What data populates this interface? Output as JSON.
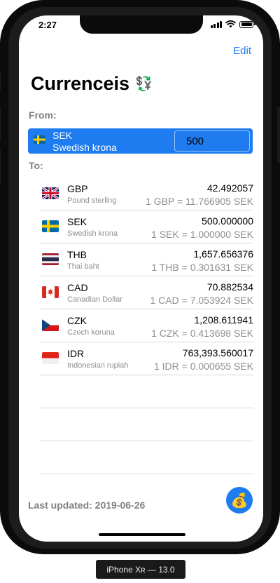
{
  "status_bar": {
    "time": "2:27"
  },
  "nav": {
    "edit_label": "Edit"
  },
  "title": {
    "text": "Currenceis",
    "icon_glyph": "💱",
    "icon": "currency-exchange-icon"
  },
  "from_label": "From:",
  "from": {
    "code": "SEK",
    "name": "Swedish krona",
    "amount": "500",
    "flag": "sweden-flag-icon"
  },
  "to_label": "To:",
  "conversions": [
    {
      "code": "GBP",
      "name": "Pound sterling",
      "amount": "42.492057",
      "rate": "1 GBP = 11.766905 SEK",
      "flag": "uk-flag-icon"
    },
    {
      "code": "SEK",
      "name": "Swedish krona",
      "amount": "500.000000",
      "rate": "1 SEK = 1.000000 SEK",
      "flag": "sweden-flag-icon"
    },
    {
      "code": "THB",
      "name": "Thai baht",
      "amount": "1,657.656376",
      "rate": "1 THB = 0.301631 SEK",
      "flag": "thailand-flag-icon"
    },
    {
      "code": "CAD",
      "name": "Canadian Dollar",
      "amount": "70.882534",
      "rate": "1 CAD = 7.053924 SEK",
      "flag": "canada-flag-icon"
    },
    {
      "code": "CZK",
      "name": "Czech koruna",
      "amount": "1,208.611941",
      "rate": "1 CZK = 0.413698 SEK",
      "flag": "czech-flag-icon"
    },
    {
      "code": "IDR",
      "name": "Indonesian rupiah",
      "amount": "763,393.560017",
      "rate": "1 IDR = 0.000655 SEK",
      "flag": "indonesia-flag-icon"
    }
  ],
  "last_updated": "Last updated: 2019-06-26",
  "fab": {
    "glyph": "💰",
    "icon": "money-bag-icon"
  },
  "device_label": "iPhone Xʀ — 13.0",
  "colors": {
    "accent": "#1e7cf0",
    "secondary_text": "#8e8e8e",
    "separator": "#d9d9d9"
  }
}
